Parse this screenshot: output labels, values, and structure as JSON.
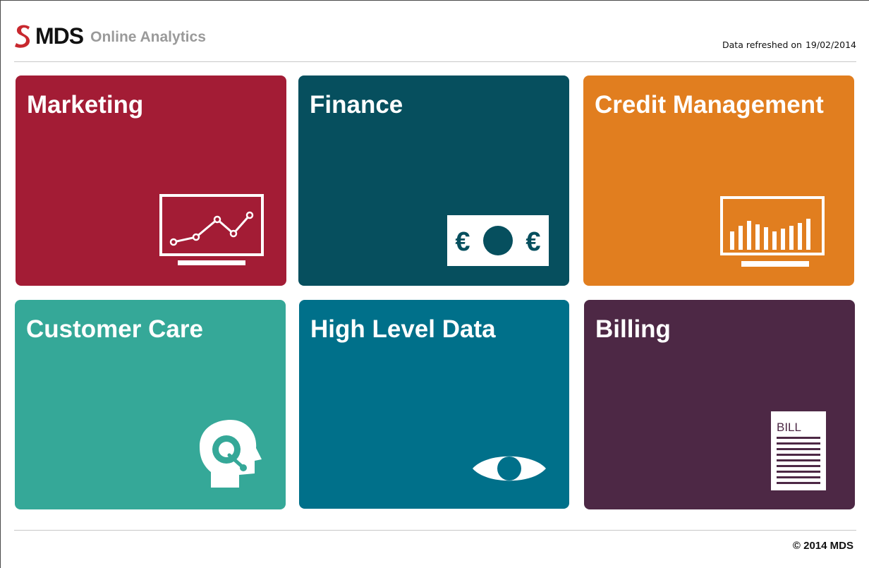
{
  "header": {
    "brand": "MDS",
    "product": "Online Analytics",
    "refresh_label": "Data refreshed on",
    "refresh_date": "19/02/2014"
  },
  "tiles": [
    {
      "title": "Marketing",
      "color": "#a31c35",
      "icon": "line-chart-monitor-icon"
    },
    {
      "title": "Finance",
      "color": "#064f5e",
      "icon": "euro-banknote-icon"
    },
    {
      "title": "Credit Management",
      "color": "#e17e1f",
      "icon": "bar-chart-monitor-icon"
    },
    {
      "title": "Customer Care",
      "color": "#35a898",
      "icon": "headset-agent-icon"
    },
    {
      "title": "High Level Data",
      "color": "#00708a",
      "icon": "eye-icon"
    },
    {
      "title": "Billing",
      "color": "#4d2845",
      "icon": "bill-document-icon"
    }
  ],
  "billing_icon_text": "BILL",
  "finance_icon_symbol": "€",
  "footer": {
    "copyright": "© 2014 MDS"
  }
}
